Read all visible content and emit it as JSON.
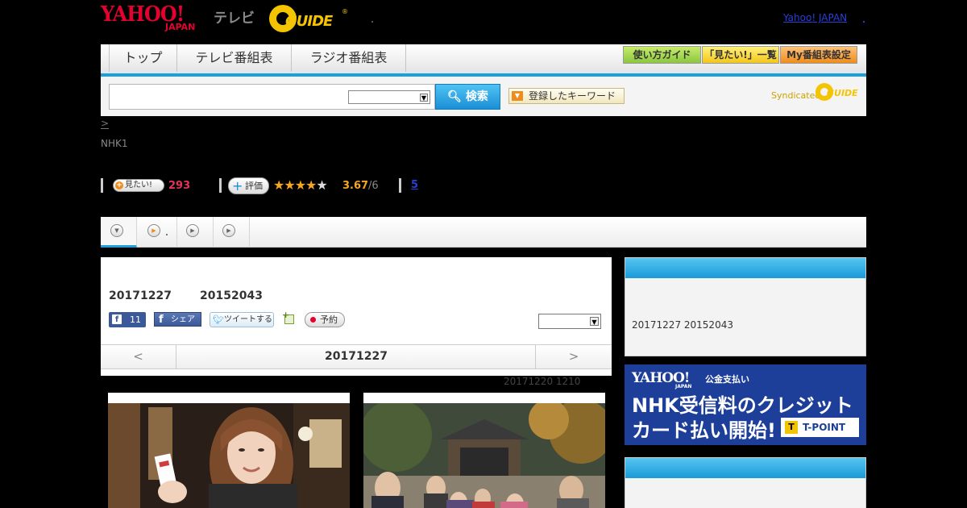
{
  "header": {
    "yahoo_logo": "YAHOO!",
    "yahoo_japan_sub": "JAPAN",
    "tv_label": "テレビ",
    "gguide_logo": "GUIDE",
    "gguide_reg": "®",
    "yahoo_japan_link": "Yahoo! JAPAN"
  },
  "nav": {
    "tabs": [
      {
        "label": "トップ"
      },
      {
        "label": "テレビ番組表"
      },
      {
        "label": "ラジオ番組表"
      }
    ],
    "buttons": {
      "guide": "使い方ガイド",
      "mitai_list": "「見たい!」一覧",
      "my_schedule": "My番組表設定"
    }
  },
  "search": {
    "input_value": "",
    "select_value": "",
    "button_label": "検索",
    "keyword_button_label": "登録したキーワード",
    "syndicated_label": "Syndicated",
    "syndicated_logo": "GUIDE"
  },
  "breadcrumb": {
    "separator": ">"
  },
  "program": {
    "channel": "NHK1",
    "mitai_label": "見たい!",
    "mitai_count": "293",
    "rating_label": "評価",
    "rating_value": 3.67,
    "rating_score_text": "3.67",
    "rating_max_text": "/6",
    "comments_count": "5"
  },
  "main": {
    "date": "20171227",
    "time": "20152043",
    "fb_like_count": "11",
    "fb_share_label": "シェア",
    "tweet_label": "ツイートする",
    "reserve_label": "予約",
    "select_value": "",
    "date_nav": {
      "prev": "<",
      "current": "20171227",
      "next": ">"
    },
    "updated": "20171220  1210"
  },
  "sidebar": {
    "box1_text": "20171227  20152043",
    "ad": {
      "logo": "YAHOO!",
      "logo_sub": "JAPAN",
      "service": "公金支払い",
      "line1": "NHK受信料のクレジット",
      "line2": "カード払い開始!",
      "tpoint": "T-POINT",
      "tpoint_mark": "T"
    }
  },
  "colors": {
    "accent_blue": "#1aa0dc",
    "yahoo_red": "#e5002d",
    "gguide_yellow": "#f5c400",
    "star_orange": "#f5a623",
    "mitai_pink": "#e5335c"
  }
}
